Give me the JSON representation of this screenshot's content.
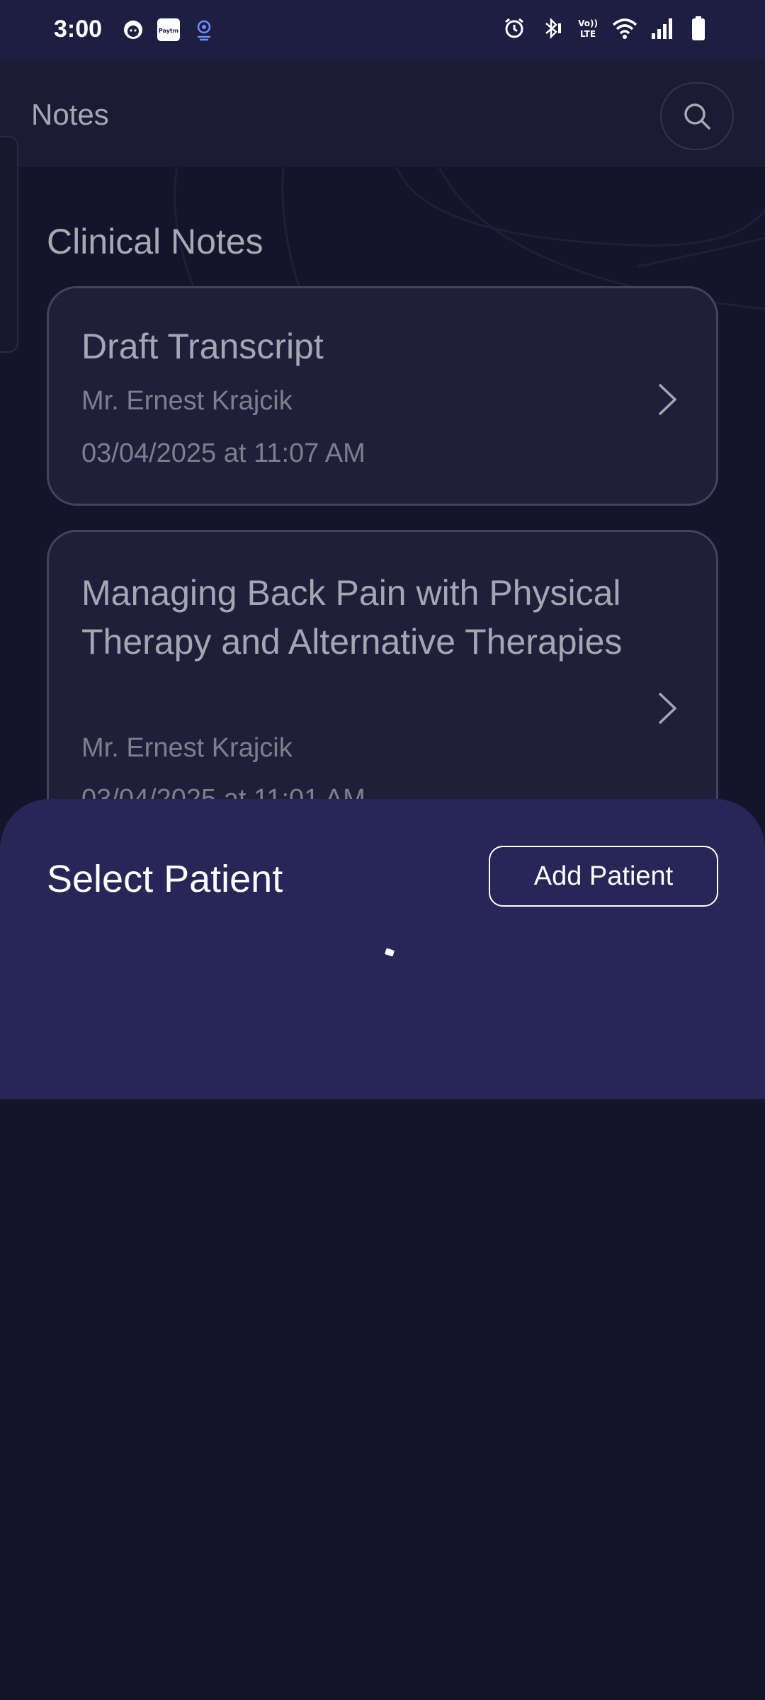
{
  "status_bar": {
    "time": "3:00",
    "left_icons": [
      "face-icon",
      "paytm-icon",
      "location-pin-icon"
    ],
    "right_icons": [
      "alarm-icon",
      "bluetooth-icon",
      "volte-icon",
      "wifi-icon",
      "signal-icon",
      "battery-icon"
    ],
    "paytm_text": "Paytm",
    "volte_text_top": "Vo))",
    "volte_text_bottom": "LTE"
  },
  "app_bar": {
    "title": "Notes",
    "search_icon": "search-icon"
  },
  "section": {
    "title": "Clinical Notes"
  },
  "notes": [
    {
      "title": "Draft Transcript",
      "patient": "Mr. Ernest Krajcik",
      "date": "03/04/2025 at 11:07 AM"
    },
    {
      "title": "Managing Back Pain with Physical Therapy and Alternative Therapies",
      "patient": "Mr. Ernest Krajcik",
      "date": "03/04/2025 at 11:01 AM"
    }
  ],
  "sheet": {
    "title": "Select Patient",
    "add_button": "Add Patient"
  },
  "colors": {
    "background": "#14142a",
    "status_bar": "#1e1e42",
    "app_bar": "#1b1b33",
    "card": "#201f3a",
    "card_border": "#45435a",
    "sheet": "#272656"
  }
}
